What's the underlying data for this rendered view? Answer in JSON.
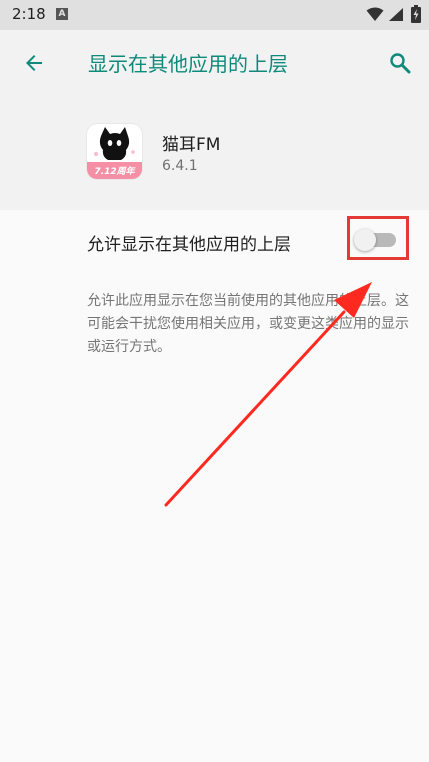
{
  "status_bar": {
    "time": "2:18",
    "notification_glyph": "A",
    "icons": [
      "wifi-icon",
      "signal-icon",
      "battery-icon"
    ]
  },
  "app_bar": {
    "title": "显示在其他应用的上层",
    "back_icon": "arrow-left-icon",
    "search_icon": "search-icon"
  },
  "app": {
    "name": "猫耳FM",
    "version": "6.4.1",
    "icon": "cat-logo-icon",
    "icon_banner": "7.12周年"
  },
  "setting": {
    "label": "允许显示在其他应用的上层",
    "enabled": false
  },
  "description": "允许此应用显示在您当前使用的其他应用的上层。这可能会干扰您使用相关应用，或变更这类应用的显示或运行方式。",
  "colors": {
    "accent": "#0f8a7a",
    "highlight": "#e53935",
    "toggle_off_track": "#b9b9b9"
  }
}
